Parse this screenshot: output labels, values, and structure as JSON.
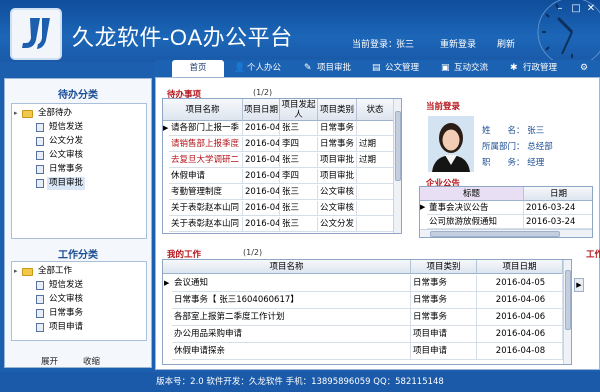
{
  "app": {
    "title": "久龙软件-OA办公平台"
  },
  "header": {
    "current_user_label": "当前登录：",
    "current_user": "张三",
    "relogin": "重新登录",
    "refresh": "刷新"
  },
  "tabs": [
    {
      "label": "首页",
      "icon": "home-icon"
    },
    {
      "label": "个人办公",
      "icon": "person-icon"
    },
    {
      "label": "项目审批",
      "icon": "edit-icon"
    },
    {
      "label": "公文管理",
      "icon": "documents-icon"
    },
    {
      "label": "互动交流",
      "icon": "chat-icon"
    },
    {
      "label": "行政管理",
      "icon": "admin-icon"
    }
  ],
  "left": {
    "todo_title": "待办分类",
    "todo_tree": {
      "root": "全部待办",
      "items": [
        "短信发送",
        "公文分发",
        "公文审核",
        "日常事务",
        "项目审批"
      ]
    },
    "work_title": "工作分类",
    "work_tree": {
      "root": "全部工作",
      "items": [
        "短信发送",
        "公文审核",
        "日常事务",
        "项目申请"
      ]
    },
    "expand": "展开",
    "collapse": "收缩"
  },
  "pending": {
    "label": "待办事项",
    "count": "(1/2)",
    "columns": [
      "项目名称",
      "项目日期",
      "项目发起人",
      "项目类别",
      "状态"
    ],
    "rows": [
      {
        "name": "请各部门上报一季",
        "date": "2016-04",
        "person": "张三",
        "type": "日常事务",
        "status": "",
        "red": false
      },
      {
        "name": "请销售部上报季度",
        "date": "2016-04",
        "person": "李四",
        "type": "日常事务",
        "status": "过期",
        "red": true
      },
      {
        "name": "去复旦大学调研二",
        "date": "2016-04",
        "person": "张三",
        "type": "项目审批",
        "status": "过期",
        "red": true
      },
      {
        "name": "休假申请",
        "date": "2016-04",
        "person": "李四",
        "type": "项目审批",
        "status": "",
        "red": false
      },
      {
        "name": "考勤管理制度",
        "date": "2016-04",
        "person": "张三",
        "type": "公文审核",
        "status": "",
        "red": false
      },
      {
        "name": "关于表彰赵本山同",
        "date": "2016-04",
        "person": "张三",
        "type": "公文审核",
        "status": "",
        "red": false
      },
      {
        "name": "关于表彰赵本山同",
        "date": "2016-04",
        "person": "张三",
        "type": "公文分发",
        "status": "",
        "red": false
      }
    ]
  },
  "profile": {
    "label": "当前登录",
    "name_k": "姓　　名：",
    "name_v": "张三",
    "dept_k": "所属部门：",
    "dept_v": "总经部",
    "post_k": "职　　务：",
    "post_v": "经理"
  },
  "notice": {
    "label": "企业公告",
    "columns": [
      "标题",
      "日期"
    ],
    "rows": [
      {
        "title": "董事会决议公告",
        "date": "2016-03-24"
      },
      {
        "title": "公司旅游放假通知",
        "date": "2016-03-24"
      }
    ]
  },
  "mywork": {
    "label": "我的工作",
    "count": "(1/2)",
    "columns": [
      "项目名称",
      "项目类别",
      "项目日期"
    ],
    "rows": [
      {
        "name": "会议通知",
        "type": "日常事务",
        "date": "2016-04-05"
      },
      {
        "name": "日常事务【 张三1604060617】",
        "type": "日常事务",
        "date": "2016-04-06"
      },
      {
        "name": "各部室上报第二季度工作计划",
        "type": "日常事务",
        "date": "2016-04-06"
      },
      {
        "name": "办公用品采购申请",
        "type": "项目申请",
        "date": "2016-04-06"
      },
      {
        "name": "休假申请探亲",
        "type": "项目申请",
        "date": "2016-04-08"
      }
    ],
    "side_label": "工作"
  },
  "footer": {
    "text": "版本号：2.0  软件开发：久龙软件  手机：13895896059  QQ：582115148"
  },
  "colors": {
    "header": "#1c66b8",
    "accent_red": "#b3141a",
    "link_blue": "#1a4e95"
  }
}
